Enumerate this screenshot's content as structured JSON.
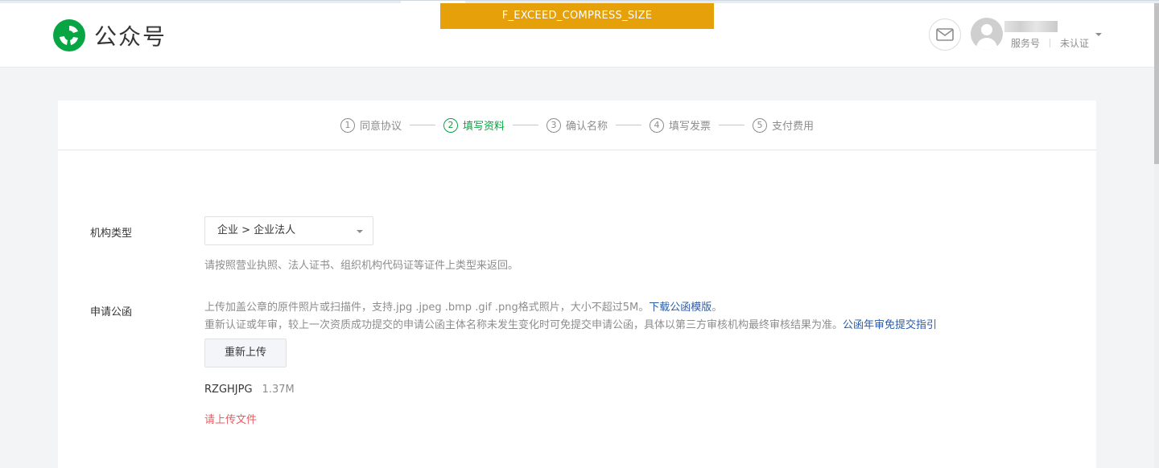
{
  "header": {
    "logo_text": "公众号",
    "warning": "F_EXCEED_COMPRESS_SIZE",
    "account_type": "服务号",
    "account_status": "未认证"
  },
  "steps": [
    {
      "num": "1",
      "label": "同意协议",
      "active": false
    },
    {
      "num": "2",
      "label": "填写资料",
      "active": true
    },
    {
      "num": "3",
      "label": "确认名称",
      "active": false
    },
    {
      "num": "4",
      "label": "填写发票",
      "active": false
    },
    {
      "num": "5",
      "label": "支付费用",
      "active": false
    }
  ],
  "form": {
    "org_type": {
      "label": "机构类型",
      "value": "企业 > 企业法人",
      "hint": "请按照营业执照、法人证书、组织机构代码证等证件上类型来返回。"
    },
    "letter": {
      "label": "申请公函",
      "hint1": "上传加盖公章的原件照片或扫描件，支持.jpg .jpeg .bmp .gif .png格式照片，大小不超过5M。",
      "hint1_link": "下载公函模版",
      "hint1_tail": "。",
      "hint2": "重新认证或年审，较上一次资质成功提交的申请公函主体名称未发生变化时可免提交申请公函，具体以第三方审核机构最终审核结果为准。",
      "hint2_link": "公函年审免提交指引",
      "reupload_label": "重新上传",
      "file_name": "RZGHJPG",
      "file_size": "1.37M",
      "error": "请上传文件"
    }
  },
  "colors": {
    "brand_green": "#07a543",
    "warning_bg": "#e6a00a",
    "link": "#2b5ba8",
    "error": "#e15f63"
  }
}
